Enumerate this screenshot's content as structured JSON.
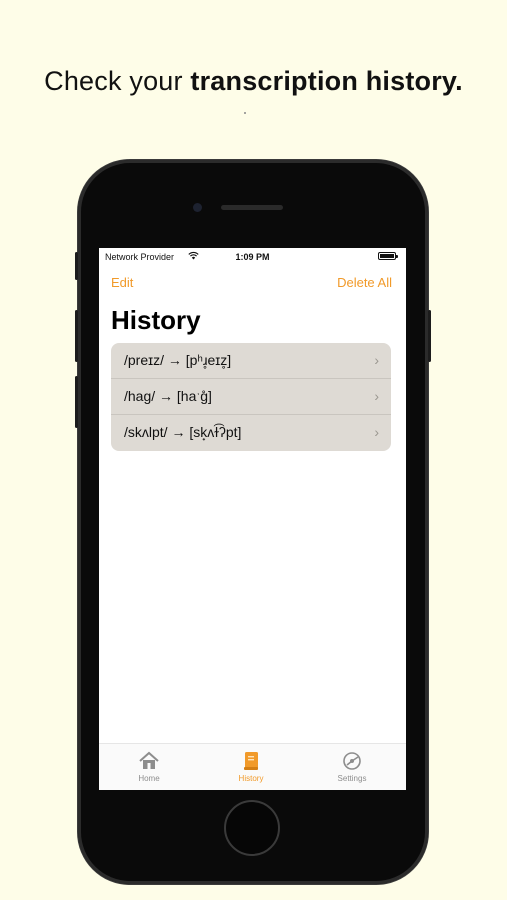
{
  "headline": {
    "normal": "Check your ",
    "bold": "transcription history."
  },
  "status_bar": {
    "carrier": "Network Provider",
    "time": "1:09 PM"
  },
  "nav": {
    "edit_label": "Edit",
    "delete_all_label": "Delete All"
  },
  "page": {
    "title": "History"
  },
  "history": [
    {
      "text": "/preɪz/  →  [pʰɹ̥eɪz̥]"
    },
    {
      "text": "/hag/  →  [haˑg̊]"
    },
    {
      "text": "/skʌlpt/  →  [sk̟ʌɫ͡ʔpt]"
    }
  ],
  "tabbar": {
    "items": [
      {
        "label": "Home",
        "icon": "house-icon",
        "active": false
      },
      {
        "label": "History",
        "icon": "book-icon",
        "active": true
      },
      {
        "label": "Settings",
        "icon": "settings-icon",
        "active": false
      }
    ]
  },
  "colors": {
    "accent": "#f19a2a",
    "page_background": "#fefde8",
    "row_background": "#dedad4"
  }
}
